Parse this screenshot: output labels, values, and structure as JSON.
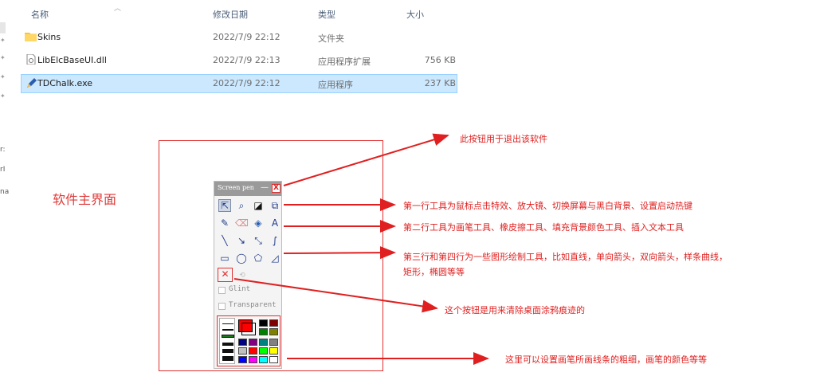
{
  "explorer": {
    "columns": {
      "name": "名称",
      "modified": "修改日期",
      "type": "类型",
      "size": "大小"
    },
    "files": [
      {
        "name": "Skins",
        "modified": "2022/7/9 22:12",
        "type": "文件夹",
        "size": "",
        "icon": "folder-icon"
      },
      {
        "name": "LibElcBaseUI.dll",
        "modified": "2022/7/9 22:13",
        "type": "应用程序扩展",
        "size": "756 KB",
        "icon": "dll-file-icon"
      },
      {
        "name": "TDChalk.exe",
        "modified": "2022/7/9 22:12",
        "type": "应用程序",
        "size": "237 KB",
        "icon": "pen-app-icon",
        "selected": true
      }
    ],
    "left_strip": [
      "r:",
      "rI",
      "na"
    ]
  },
  "main_label": "软件主界面",
  "widget": {
    "title": "Screen pen",
    "minimize": "—",
    "close": "X",
    "glint_label": "Glint",
    "transparent_label": "Transparent"
  },
  "annotations": {
    "exit": "此按钮用于退出该软件",
    "row1": "第一行工具为鼠标点击特效、放大镜、切换屏幕与黑白背景、设置启动热键",
    "row2": "第二行工具为画笔工具、橡皮擦工具、填充背景颜色工具、插入文本工具",
    "row34_line1": "第三行和第四行为一些图形绘制工具，比如直线，单向箭头，双向箭头，样条曲线，",
    "row34_line2": "矩形，椭圆等等",
    "clear": "这个按钮是用来清除桌面涂鸦痕迹的",
    "pen": "这里可以设置画笔所画线条的粗细，画笔的颜色等等"
  },
  "colors": {
    "annotation": "#e02020",
    "selection": "#cce8ff",
    "current_color": "#ff0000",
    "palette": [
      "#000000",
      "#800000",
      "#008000",
      "#808000",
      "#000080",
      "#800080",
      "#008080",
      "#808080",
      "#c0c0c0",
      "#ff0000",
      "#00ff00",
      "#ffff00",
      "#0000ff",
      "#ff00ff",
      "#00ffff",
      "#ffffff"
    ]
  }
}
